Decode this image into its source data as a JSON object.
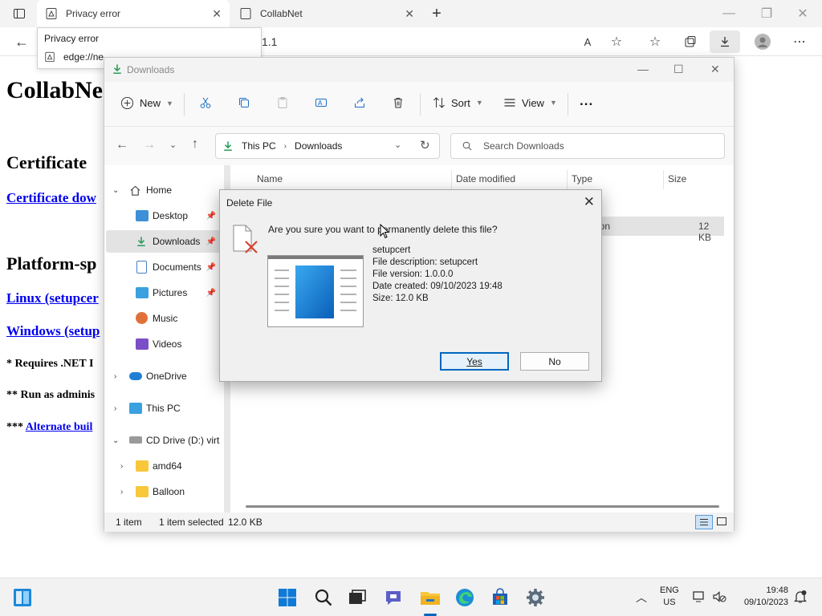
{
  "browser": {
    "tabs": [
      {
        "label": "Privacy error",
        "active": true
      },
      {
        "label": "CollabNet",
        "active": false
      }
    ],
    "address_fragment": "1.1",
    "tooltip": {
      "title": "Privacy error",
      "url": "edge://ne"
    }
  },
  "page": {
    "heading": "CollabNe",
    "cert_heading": "Certificate",
    "cert_link": "Certificate dow",
    "platform_heading": "Platform-sp",
    "linux_link": "Linux (setupcer",
    "windows_link": "Windows (setup",
    "req_note": "* Requires .NET I",
    "admin_note": "** Run as adminis",
    "alt_prefix": "***",
    "alt_link": "Alternate buil"
  },
  "explorer": {
    "title": "Downloads",
    "commands": {
      "new": "New",
      "sort": "Sort",
      "view": "View",
      "more": "..."
    },
    "breadcrumb": [
      "This PC",
      "Downloads"
    ],
    "search_placeholder": "Search Downloads",
    "sidebar": [
      {
        "label": "Home"
      },
      {
        "label": "Desktop"
      },
      {
        "label": "Downloads"
      },
      {
        "label": "Documents"
      },
      {
        "label": "Pictures"
      },
      {
        "label": "Music"
      },
      {
        "label": "Videos"
      },
      {
        "label": "OneDrive"
      },
      {
        "label": "This PC"
      },
      {
        "label": "CD Drive (D:) virt"
      },
      {
        "label": "amd64"
      },
      {
        "label": "Balloon"
      }
    ],
    "columns": {
      "name": "Name",
      "date_modified": "Date modified",
      "type": "Type",
      "size": "Size"
    },
    "file_row": {
      "type_fragment": "ation",
      "size": "12 KB"
    },
    "status": {
      "count": "1 item",
      "selected": "1 item selected",
      "size": "12.0 KB"
    }
  },
  "dialog": {
    "title": "Delete File",
    "question": "Are you sure you want to permanently delete this file?",
    "file_name": "setupcert",
    "file_description": "File description: setupcert",
    "file_version": "File version: 1.0.0.0",
    "date_created": "Date created: 09/10/2023 19:48",
    "size": "Size: 12.0 KB",
    "yes_label": "Yes",
    "no_label": "No"
  },
  "taskbar": {
    "lang_top": "ENG",
    "lang_bottom": "US",
    "time": "19:48",
    "date": "09/10/2023"
  },
  "colors": {
    "accent": "#0067c0",
    "link": "#0000ee",
    "folder": "#f8c73a"
  }
}
